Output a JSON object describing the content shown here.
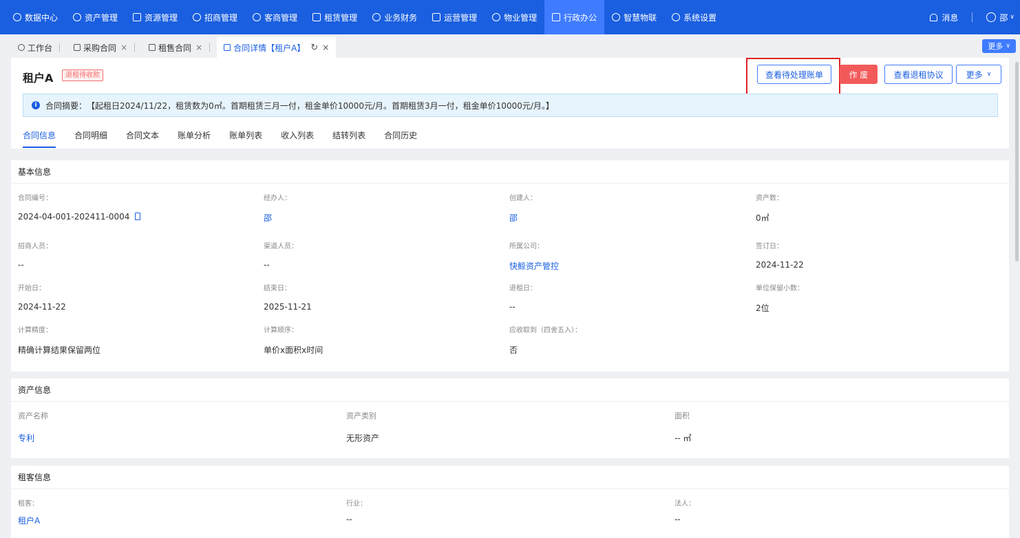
{
  "nav": {
    "items": [
      {
        "label": "数据中心",
        "icon": "dashboard-icon"
      },
      {
        "label": "资产管理",
        "icon": "cube-icon"
      },
      {
        "label": "资源管理",
        "icon": "building-icon"
      },
      {
        "label": "招商管理",
        "icon": "tag-icon"
      },
      {
        "label": "客商管理",
        "icon": "users-icon"
      },
      {
        "label": "租赁管理",
        "icon": "home-icon"
      },
      {
        "label": "业务财务",
        "icon": "finance-icon"
      },
      {
        "label": "运营管理",
        "icon": "chart-icon"
      },
      {
        "label": "物业管理",
        "icon": "property-icon"
      },
      {
        "label": "行政办公",
        "icon": "office-icon"
      },
      {
        "label": "智慧物联",
        "icon": "iot-icon"
      },
      {
        "label": "系统设置",
        "icon": "gear-icon"
      }
    ],
    "active_index": 9,
    "messages_label": "消息",
    "user_label": "邵"
  },
  "tabs": {
    "items": [
      {
        "label": "工作台",
        "closable": false
      },
      {
        "label": "采购合同",
        "closable": true
      },
      {
        "label": "租售合同",
        "closable": true
      },
      {
        "label": "合同详情【租户A】",
        "closable": true
      }
    ],
    "more_label": "更多"
  },
  "header": {
    "title": "租户A",
    "badge": "退租待收款",
    "buttons": {
      "pending_bills": "查看待处理账单",
      "void": "作 废",
      "view_agreement": "查看退租协议",
      "more": "更多"
    },
    "summary_label": "合同摘要：",
    "summary_text": "【起租日2024/11/22，租赁数为0㎡。首期租赁三月一付，租金单价10000元/月。首期租赁3月一付，租金单价10000元/月。】"
  },
  "subtabs": [
    "合同信息",
    "合同明细",
    "合同文本",
    "账单分析",
    "账单列表",
    "收入列表",
    "结转列表",
    "合同历史"
  ],
  "basic_info": {
    "title": "基本信息",
    "contract_no_label": "合同编号：",
    "contract_no": "2024-04-001-202411-0004",
    "handler_label": "经办人：",
    "handler": "邵",
    "creator_label": "创建人：",
    "creator": "邵",
    "asset_count_label": "资产数：",
    "asset_count": "0㎡",
    "recruiter_label": "招商人员：",
    "recruiter": "--",
    "channel_label": "渠道人员：",
    "channel": "--",
    "company_label": "所属公司：",
    "company": "快鲸资产管控",
    "sign_date_label": "签订日：",
    "sign_date": "2024-11-22",
    "start_label": "开始日：",
    "start": "2024-11-22",
    "end_label": "结束日：",
    "end": "2025-11-21",
    "exit_label": "退租日：",
    "exit": "--",
    "decimal_label": "单位保留小数：",
    "decimal": "2位",
    "precision_label": "计算精度：",
    "precision": "精确计算结果保留两位",
    "order_label": "计算顺序：",
    "order": "单价x面积x时间",
    "round_label": "应收取到（四舍五入）：",
    "round": "否"
  },
  "asset_info": {
    "title": "资产信息",
    "name_label": "资产名称",
    "name": "专利",
    "type_label": "资产类别",
    "type": "无形资产",
    "area_label": "面积",
    "area": "-- ㎡"
  },
  "tenant_info": {
    "title": "租客信息",
    "tenant_label": "租客：",
    "tenant": "租户A",
    "industry_label": "行业：",
    "industry": "--",
    "legal_label": "法人：",
    "legal": "--"
  }
}
